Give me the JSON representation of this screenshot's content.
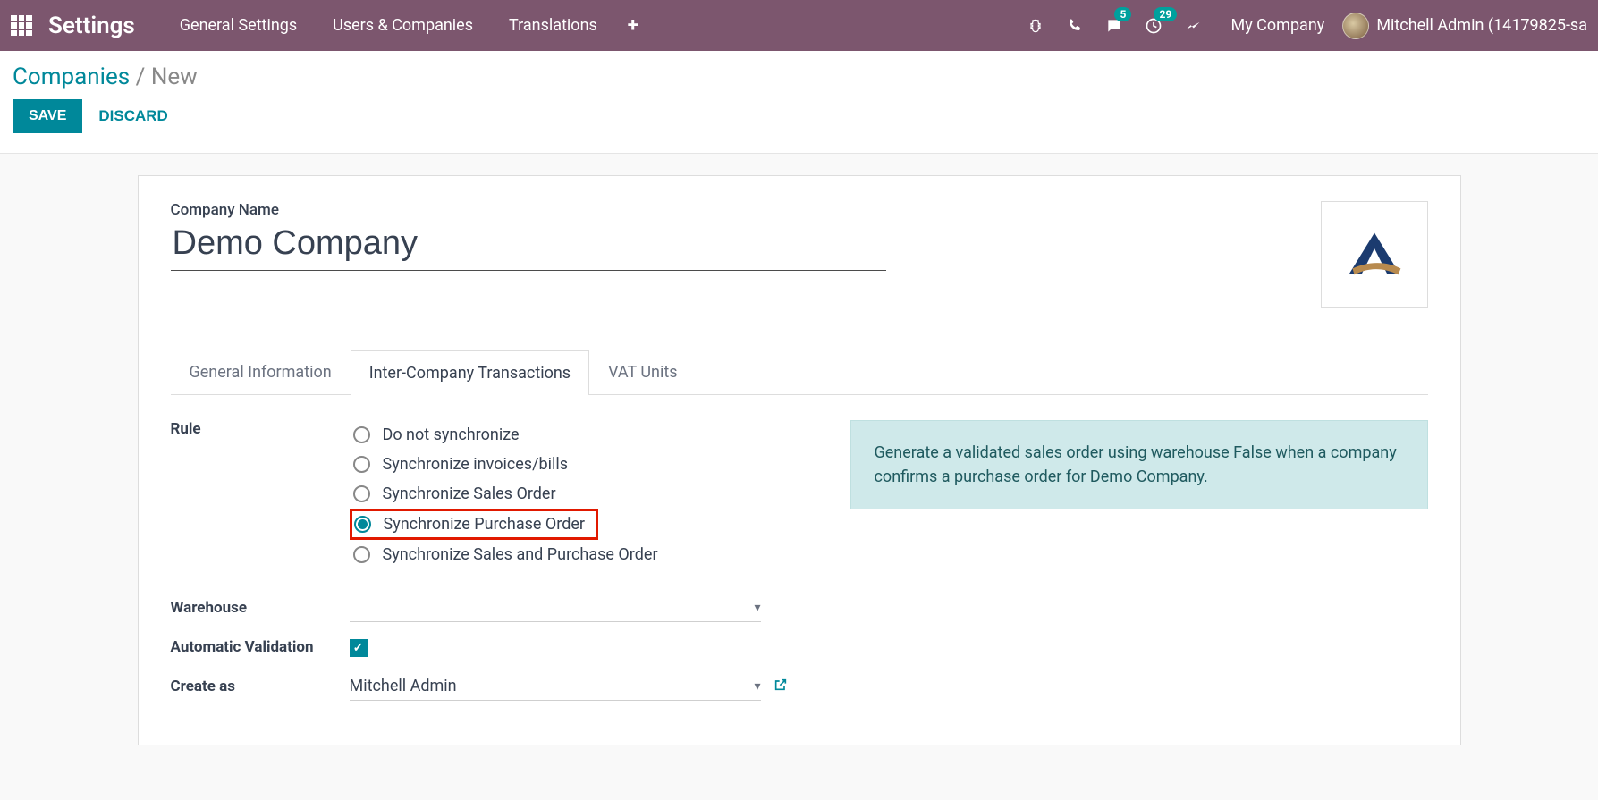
{
  "topbar": {
    "app_title": "Settings",
    "menus": [
      "General Settings",
      "Users & Companies",
      "Translations"
    ],
    "messaging_badge": "5",
    "activity_badge": "29",
    "company": "My Company",
    "user": "Mitchell Admin (14179825-sa"
  },
  "breadcrumb": {
    "root": "Companies",
    "current": "New"
  },
  "actions": {
    "save": "SAVE",
    "discard": "DISCARD"
  },
  "form": {
    "company_name_label": "Company Name",
    "company_name_value": "Demo Company",
    "tabs": [
      "General Information",
      "Inter-Company Transactions",
      "VAT Units"
    ],
    "active_tab": 1,
    "rule_label": "Rule",
    "rule_options": [
      "Do not synchronize",
      "Synchronize invoices/bills",
      "Synchronize Sales Order",
      "Synchronize Purchase Order",
      "Synchronize Sales and Purchase Order"
    ],
    "rule_selected": 3,
    "warehouse_label": "Warehouse",
    "warehouse_value": "",
    "auto_validation_label": "Automatic Validation",
    "auto_validation_checked": true,
    "create_as_label": "Create as",
    "create_as_value": "Mitchell Admin",
    "info_text": "Generate a validated sales order using warehouse False when a company confirms a purchase order for Demo Company."
  }
}
